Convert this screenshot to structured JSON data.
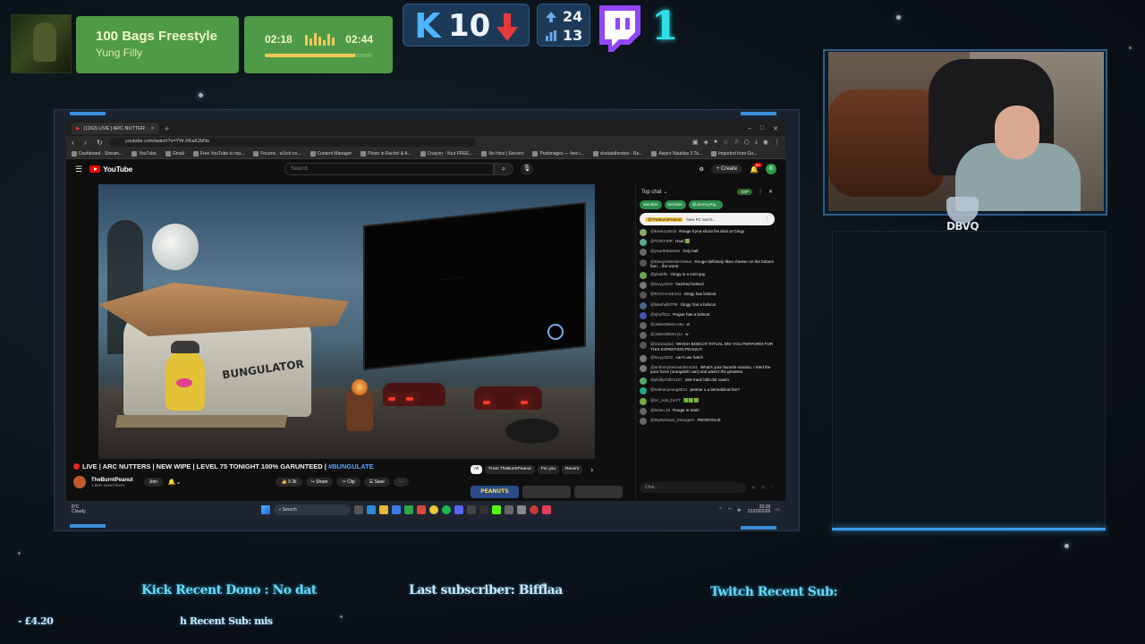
{
  "overlay": {
    "song": {
      "title": "100 Bags Freestyle",
      "artist": "Yung Filly"
    },
    "player": {
      "elapsed": "02:18",
      "total": "02:44",
      "progress": 0.84
    },
    "kick": {
      "count": "10",
      "trend": "down"
    },
    "stats": {
      "top": "24",
      "bottom": "13"
    },
    "twitch": {
      "count": "1"
    },
    "webcam_logo": "DBVQ",
    "tickers": {
      "kick_dono": "Kick Recent Dono : No dat",
      "last_sub": "Last subscriber: Bifflaa",
      "twitch_sub": "Twitch Recent Sub: Mist",
      "left_amount": "- £4.20",
      "h_recent": "h Recent Sub: mis"
    },
    "colors": {
      "green_card": "#4f9a46",
      "kick_blue": "#4fb3ff",
      "cyan": "#2fe0e8",
      "accent_blue": "#3b9ee8"
    }
  },
  "browser": {
    "tab_title": "(1162) LIVE | ARC NUTTER",
    "url": "youtube.com/watch?v=YW-XKaK2bNs",
    "bookmarks": [
      "Dashboard - Stream...",
      "YouTube",
      "Gmail",
      "Free YouTube to mp...",
      "Forums - w1tch co...",
      "Content Manager",
      "Photo in Rachel & A...",
      "Craiyon - Your FREE...",
      "No Hesi | Servers",
      "Postimages — free i...",
      "vindatatheotoo - Ra...",
      "Aspire Nautilus 3 Ta...",
      "Imported from Go..."
    ]
  },
  "youtube": {
    "logo": "YouTube",
    "search_placeholder": "Search",
    "create": "Create",
    "notif_count": "9+",
    "user_initial": "B",
    "video_title_prefix": "LIVE | ARC NUTTERS | NEW WIPE | LEVEL 75 TONIGHT 100% GARUNTEED | ",
    "video_hashtag": "#BUNGULATE",
    "channel": {
      "name": "TheBurntPeanut",
      "subs": "1.68m subscribers"
    },
    "join": "Join",
    "actions": [
      "9.3k",
      "Share",
      "Clip",
      "Save"
    ],
    "rec_tabs": [
      "All",
      "From TheBurntPeanut",
      "For you",
      "Recent"
    ],
    "thumb_label": "PEANUTS",
    "scene_graffiti": "BUNGULATOR"
  },
  "chat": {
    "header": "Top chat",
    "xp_pill": "0XP",
    "members": [
      "Member",
      "Member",
      "@JeremyRig..."
    ],
    "pinned": {
      "user": "@TheBurntPeanut",
      "text": "New PC and K..."
    },
    "input_placeholder": "Chat...",
    "messages": [
      {
        "user": "@Breezy3610",
        "text": "Rouge tryna shoot his shot at Gingy",
        "color": "#8a6"
      },
      {
        "user": "@TONYWR",
        "text": "Heal 🟩",
        "color": "#5a8"
      },
      {
        "user": "@your9r9viewer",
        "text": "holy ball",
        "color": "#666"
      },
      {
        "user": "@DewysWesternWear",
        "text": "Rouge definitely likes cheese on the bottom bun... the worst",
        "color": "#555"
      },
      {
        "user": "@pladdle",
        "text": "Gingy is a cool guy",
        "color": "#6a5"
      },
      {
        "user": "@loxyy4202",
        "text": "hatched looked",
        "color": "#777"
      },
      {
        "user": "@RVCHASE101",
        "text": "Gingy has bobcat",
        "color": "#555"
      },
      {
        "user": "@lukehull8709",
        "text": "Gingy has a bobcat",
        "color": "#468"
      },
      {
        "user": "@rjhuff311",
        "text": "Rogue has a bobcat",
        "color": "#45a"
      },
      {
        "user": "@JakeOBrien-x5u",
        "text": "w",
        "color": "#666"
      },
      {
        "user": "@JakeOBrien-j1v",
        "text": "w",
        "color": "#666"
      },
      {
        "user": "@311Exploit",
        "text": "WHICH BOBCAT RITUAL DID YOU PERFORM FOR THIS EXPIDITION PEANUT.",
        "color": "#555"
      },
      {
        "user": "@loxyy4202",
        "text": "can't use hatch",
        "color": "#777"
      },
      {
        "user": "@anthonyhernandez4191",
        "text": "What's your favorite voodoo, I tried the juice force (orangeish can) and wasn't the greatest",
        "color": "#777"
      },
      {
        "user": "@phillychillz1337",
        "text": "rare track bdb dot cawm",
        "color": "#5a6"
      },
      {
        "user": "@nathanyoung9021",
        "text": "peanut u a lamealdcat fan?",
        "color": "#2a8"
      },
      {
        "user": "@ric_solo_boYT",
        "text": "🟩🟩🟩",
        "color": "#7a4"
      },
      {
        "user": "@loosu.18",
        "text": "Rouge is trash",
        "color": "#666"
      },
      {
        "user": "@Mysterious_Strangers",
        "text": "#NOROGUE",
        "color": "#666"
      }
    ]
  },
  "taskbar": {
    "weather_temp": "8°C",
    "weather_desc": "Cloudy",
    "search": "Search",
    "time": "20:26",
    "date": "01/03/2026"
  }
}
